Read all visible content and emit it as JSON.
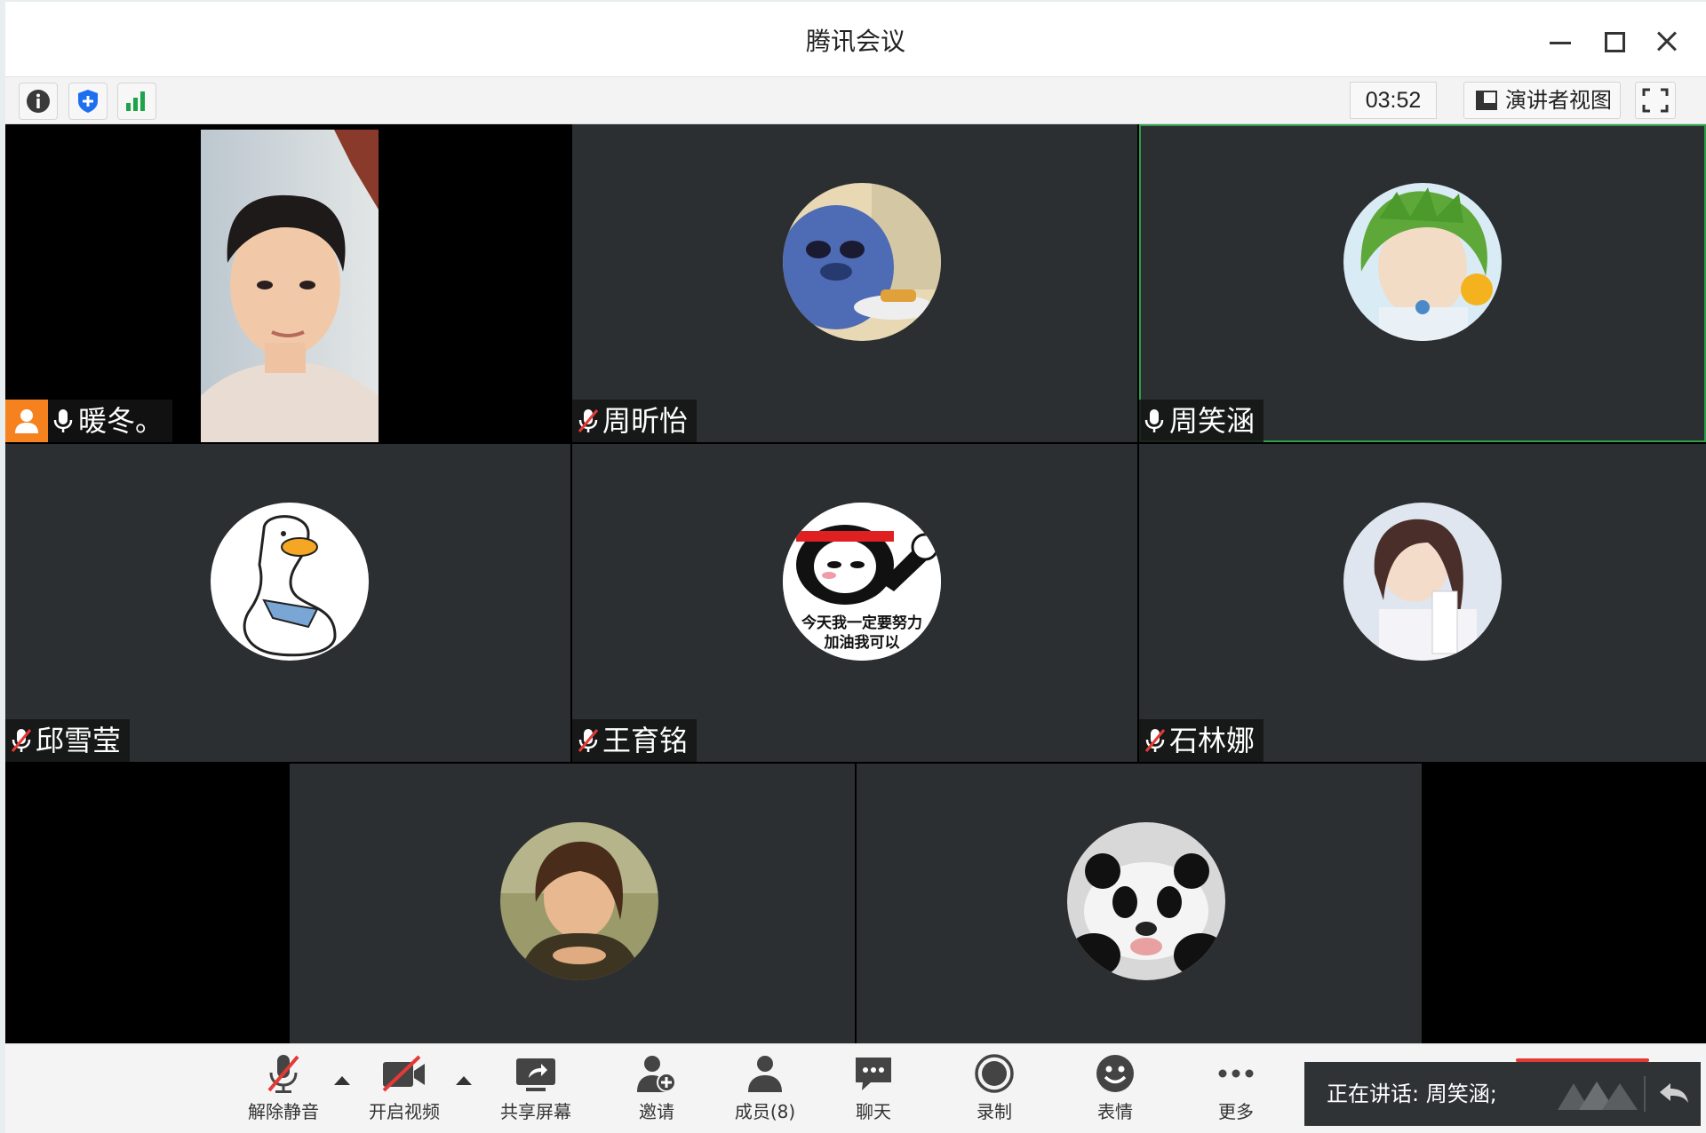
{
  "window": {
    "title": "腾讯会议"
  },
  "infobar": {
    "timer": "03:52",
    "speaker_view_label": "演讲者视图"
  },
  "participants": [
    {
      "name": "暖冬。",
      "mic": "on",
      "host": true,
      "video": "on"
    },
    {
      "name": "周昕怡",
      "mic": "muted"
    },
    {
      "name": "周笑涵",
      "mic": "on",
      "speaking": true
    },
    {
      "name": "邱雪莹",
      "mic": "muted"
    },
    {
      "name": "王育铭",
      "mic": "muted",
      "avatar_text": [
        "今天我一定要努力",
        "加油我可以"
      ]
    },
    {
      "name": "石林娜",
      "mic": "muted"
    },
    {
      "name": "",
      "mic": "none"
    },
    {
      "name": "",
      "mic": "none"
    }
  ],
  "toolbar": {
    "unmute_label": "解除静音",
    "start_video_label": "开启视频",
    "share_screen_label": "共享屏幕",
    "invite_label": "邀请",
    "members_label": "成员(8)",
    "chat_label": "聊天",
    "record_label": "录制",
    "reaction_label": "表情",
    "more_label": "更多"
  },
  "speaking_panel": {
    "text": "正在讲话: 周笑涵;"
  },
  "colors": {
    "tile_bg": "#2c2f31",
    "active_border": "#2f9e4a",
    "host_badge": "#f5821f",
    "mute_red": "#e53935"
  }
}
